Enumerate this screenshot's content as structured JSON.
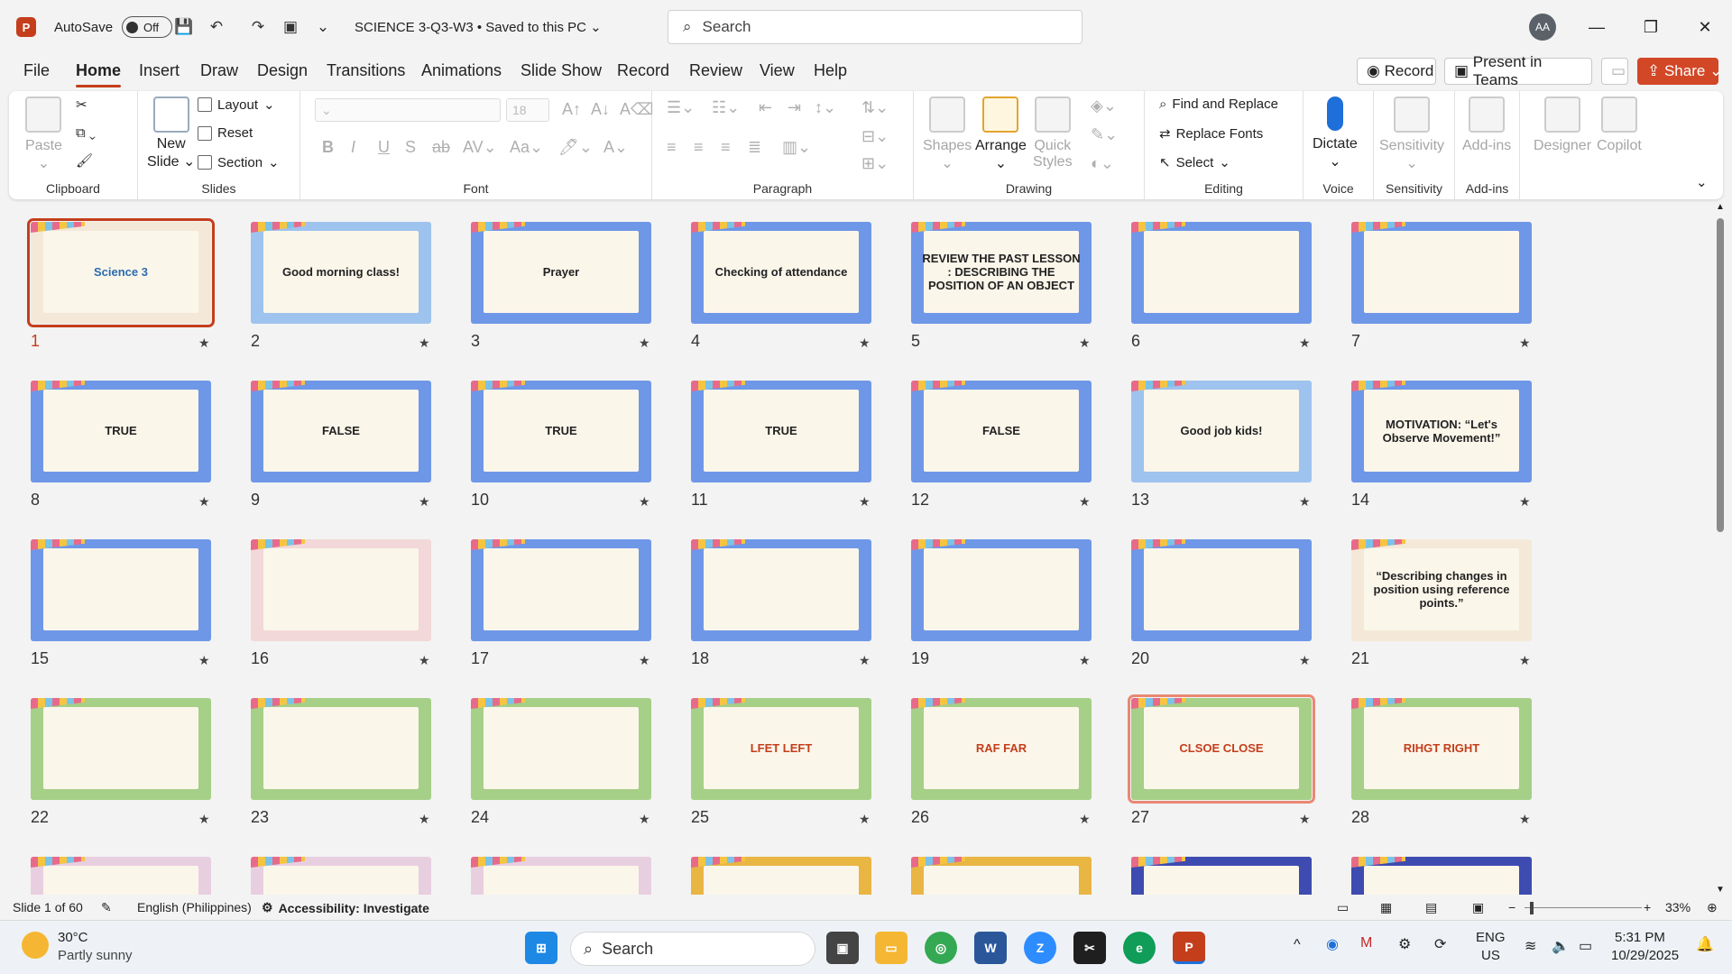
{
  "colors": {
    "accent": "#c43e1c",
    "share": "#d24726"
  },
  "titlebar": {
    "autosave_label": "AutoSave",
    "autosave_state": "Off",
    "doc_title": "SCIENCE 3-Q3-W3 • Saved to this PC",
    "search_placeholder": "Search",
    "avatar_initials": "AA"
  },
  "tabs": [
    "File",
    "Home",
    "Insert",
    "Draw",
    "Design",
    "Transitions",
    "Animations",
    "Slide Show",
    "Record",
    "Review",
    "View",
    "Help"
  ],
  "top_buttons": {
    "record": "Record",
    "present": "Present in Teams",
    "share": "Share"
  },
  "ribbon": {
    "clipboard": {
      "label": "Clipboard",
      "paste": "Paste"
    },
    "slides": {
      "label": "Slides",
      "new_slide": "New",
      "new_slide2": "Slide",
      "layout": "Layout",
      "reset": "Reset",
      "section": "Section"
    },
    "font": {
      "label": "Font",
      "size": "18"
    },
    "paragraph": {
      "label": "Paragraph"
    },
    "drawing": {
      "label": "Drawing",
      "shapes": "Shapes",
      "arrange": "Arrange",
      "quick": "Quick",
      "styles": "Styles"
    },
    "editing": {
      "label": "Editing",
      "find": "Find and Replace",
      "replace_fonts": "Replace Fonts",
      "select": "Select"
    },
    "voice": {
      "label": "Voice",
      "dictate": "Dictate"
    },
    "sensitivity": {
      "label": "Sensitivity",
      "btn": "Sensitivity"
    },
    "addins": {
      "label": "Add-ins",
      "btn": "Add-ins"
    },
    "designer": "Designer",
    "copilot": "Copilot"
  },
  "slides": [
    {
      "n": "1",
      "text": "Science 3",
      "bg": "#f4e9d8",
      "fg": "#2b6cb0"
    },
    {
      "n": "2",
      "text": "Good morning class!",
      "bg": "#9ec3ee",
      "fg": "#222"
    },
    {
      "n": "3",
      "text": "Prayer",
      "bg": "#6f97e8",
      "fg": "#222"
    },
    {
      "n": "4",
      "text": "Checking of attendance",
      "bg": "#6f97e8",
      "fg": "#222"
    },
    {
      "n": "5",
      "text": "REVIEW THE PAST LESSON : DESCRIBING THE POSITION OF AN OBJECT",
      "bg": "#6f97e8",
      "fg": "#222"
    },
    {
      "n": "6",
      "text": "",
      "bg": "#6f97e8",
      "fg": "#222"
    },
    {
      "n": "7",
      "text": "",
      "bg": "#6f97e8",
      "fg": "#222"
    },
    {
      "n": "8",
      "text": "TRUE",
      "bg": "#6f97e8",
      "fg": "#222"
    },
    {
      "n": "9",
      "text": "FALSE",
      "bg": "#6f97e8",
      "fg": "#222"
    },
    {
      "n": "10",
      "text": "TRUE",
      "bg": "#6f97e8",
      "fg": "#222"
    },
    {
      "n": "11",
      "text": "TRUE",
      "bg": "#6f97e8",
      "fg": "#222"
    },
    {
      "n": "12",
      "text": "FALSE",
      "bg": "#6f97e8",
      "fg": "#222"
    },
    {
      "n": "13",
      "text": "Good job kids!",
      "bg": "#9ec3ee",
      "fg": "#222"
    },
    {
      "n": "14",
      "text": "MOTIVATION: “Let's Observe Movement!”",
      "bg": "#6f97e8",
      "fg": "#222"
    },
    {
      "n": "15",
      "text": "",
      "bg": "#6f97e8",
      "fg": "#222"
    },
    {
      "n": "16",
      "text": "",
      "bg": "#f2d8d8",
      "fg": "#222"
    },
    {
      "n": "17",
      "text": "",
      "bg": "#6f97e8",
      "fg": "#222"
    },
    {
      "n": "18",
      "text": "",
      "bg": "#6f97e8",
      "fg": "#222"
    },
    {
      "n": "19",
      "text": "",
      "bg": "#6f97e8",
      "fg": "#222"
    },
    {
      "n": "20",
      "text": "",
      "bg": "#6f97e8",
      "fg": "#222"
    },
    {
      "n": "21",
      "text": "“Describing changes in position using reference points.”",
      "bg": "#f4e9d8",
      "fg": "#222"
    },
    {
      "n": "22",
      "text": "",
      "bg": "#a6cf87",
      "fg": "#222"
    },
    {
      "n": "23",
      "text": "",
      "bg": "#a6cf87",
      "fg": "#222"
    },
    {
      "n": "24",
      "text": "",
      "bg": "#a6cf87",
      "fg": "#222"
    },
    {
      "n": "25",
      "text": "LFET LEFT",
      "bg": "#a6cf87",
      "fg": "#c43e1c"
    },
    {
      "n": "26",
      "text": "RAF FAR",
      "bg": "#a6cf87",
      "fg": "#c43e1c"
    },
    {
      "n": "27",
      "text": "CLSOE CLOSE",
      "bg": "#a6cf87",
      "fg": "#c43e1c"
    },
    {
      "n": "28",
      "text": "RIHGT RIGHT",
      "bg": "#a6cf87",
      "fg": "#c43e1c"
    },
    {
      "n": "",
      "text": "",
      "bg": "#e8cfe0",
      "fg": "#222"
    },
    {
      "n": "",
      "text": "",
      "bg": "#e8cfe0",
      "fg": "#222"
    },
    {
      "n": "",
      "text": "",
      "bg": "#e8cfe0",
      "fg": "#222"
    },
    {
      "n": "",
      "text": "",
      "bg": "#e9b543",
      "fg": "#222"
    },
    {
      "n": "",
      "text": "",
      "bg": "#e9b543",
      "fg": "#222"
    },
    {
      "n": "",
      "text": "",
      "bg": "#3e4bb0",
      "fg": "#fff"
    },
    {
      "n": "",
      "text": "",
      "bg": "#3e4bb0",
      "fg": "#fff"
    }
  ],
  "status": {
    "slide": "Slide 1 of 60",
    "language": "English (Philippines)",
    "accessibility": "Accessibility: Investigate",
    "zoom": "33%"
  },
  "taskbar": {
    "temp": "30°C",
    "weather": "Partly sunny",
    "search": "Search",
    "lang1": "ENG",
    "lang2": "US",
    "time": "5:31 PM",
    "date": "10/29/2025"
  }
}
